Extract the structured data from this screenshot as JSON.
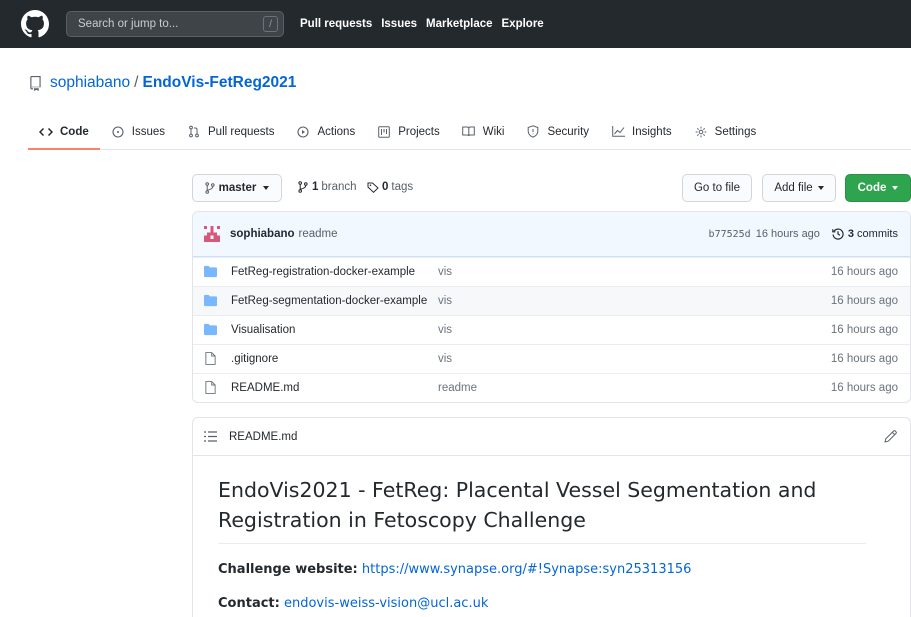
{
  "header": {
    "search_placeholder": "Search or jump to...",
    "slash_key": "/",
    "nav": [
      "Pull requests",
      "Issues",
      "Marketplace",
      "Explore"
    ]
  },
  "repo": {
    "owner": "sophiabano",
    "separator": "/",
    "name": "EndoVis-FetReg2021"
  },
  "tabs": [
    {
      "label": "Code",
      "icon": "code-icon",
      "selected": true
    },
    {
      "label": "Issues",
      "icon": "issue-icon"
    },
    {
      "label": "Pull requests",
      "icon": "pull-request-icon"
    },
    {
      "label": "Actions",
      "icon": "play-icon"
    },
    {
      "label": "Projects",
      "icon": "project-icon"
    },
    {
      "label": "Wiki",
      "icon": "book-icon"
    },
    {
      "label": "Security",
      "icon": "shield-icon"
    },
    {
      "label": "Insights",
      "icon": "graph-icon"
    },
    {
      "label": "Settings",
      "icon": "gear-icon"
    }
  ],
  "toolbar": {
    "branch": "master",
    "branches_count": "1",
    "branches_label": "branch",
    "tags_count": "0",
    "tags_label": "tags",
    "go_to_file": "Go to file",
    "add_file": "Add file",
    "code": "Code"
  },
  "commit": {
    "author": "sophiabano",
    "message": "readme",
    "sha": "b77525d",
    "age": "16 hours ago",
    "commits_count": "3",
    "commits_label": "commits"
  },
  "files": [
    {
      "name": "FetReg-registration-docker-example",
      "type": "folder",
      "commit": "vis",
      "age": "16 hours ago"
    },
    {
      "name": "FetReg-segmentation-docker-example",
      "type": "folder",
      "commit": "vis",
      "age": "16 hours ago"
    },
    {
      "name": "Visualisation",
      "type": "folder",
      "commit": "vis",
      "age": "16 hours ago"
    },
    {
      "name": ".gitignore",
      "type": "file",
      "commit": "vis",
      "age": "16 hours ago"
    },
    {
      "name": "README.md",
      "type": "file",
      "commit": "readme",
      "age": "16 hours ago"
    }
  ],
  "readme": {
    "filename": "README.md",
    "heading": "EndoVis2021 - FetReg: Placental Vessel Segmentation and Registration in Fetoscopy Challenge",
    "website_label": "Challenge website:",
    "website_url": "https://www.synapse.org/#!Synapse:syn25313156",
    "contact_label": "Contact:",
    "contact_email": "endovis-weiss-vision@ucl.ac.uk"
  },
  "colors": {
    "header_bg": "#24292e",
    "link": "#0366d6",
    "green_button": "#2ea44f",
    "tab_underline": "#f9826c",
    "folder": "#79b8ff"
  }
}
